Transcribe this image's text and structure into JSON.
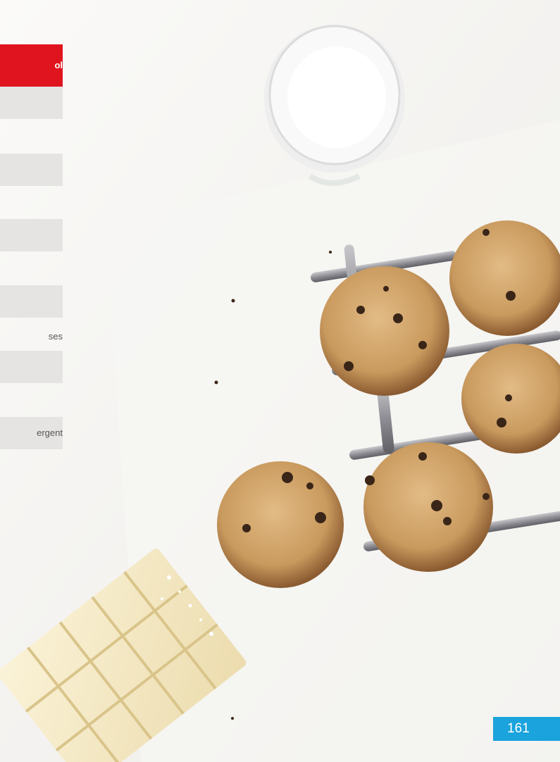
{
  "table": {
    "header_fragment": "ol",
    "row_texts": [
      "ses",
      "ergent"
    ]
  },
  "page": {
    "number": "161"
  },
  "colors": {
    "header_red": "#e0141e",
    "row_gray": "#e5e4e3",
    "page_badge_blue": "#1aa3dc"
  }
}
